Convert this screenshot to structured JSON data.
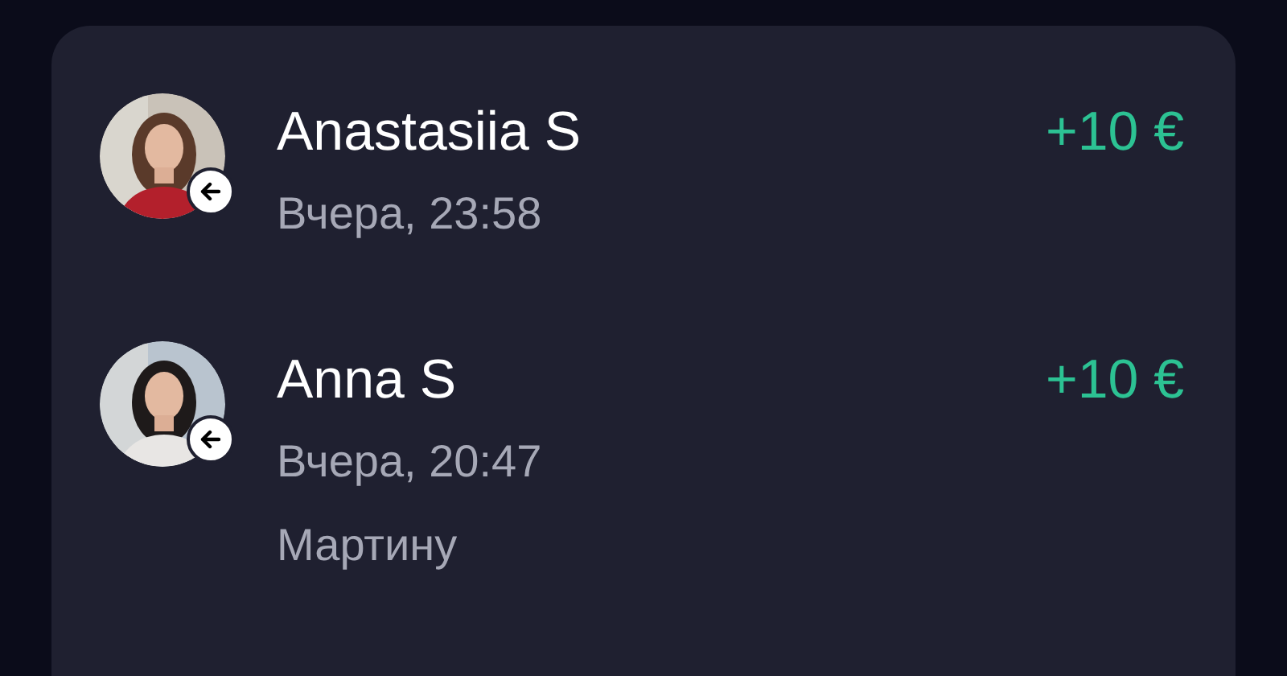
{
  "transactions": [
    {
      "name": "Anastasiia S",
      "time": "Вчера, 23:58",
      "amount": "+10 €"
    },
    {
      "name": "Anna S",
      "time": "Вчера, 20:47",
      "amount": "+10 €",
      "note": "Мартину"
    }
  ]
}
